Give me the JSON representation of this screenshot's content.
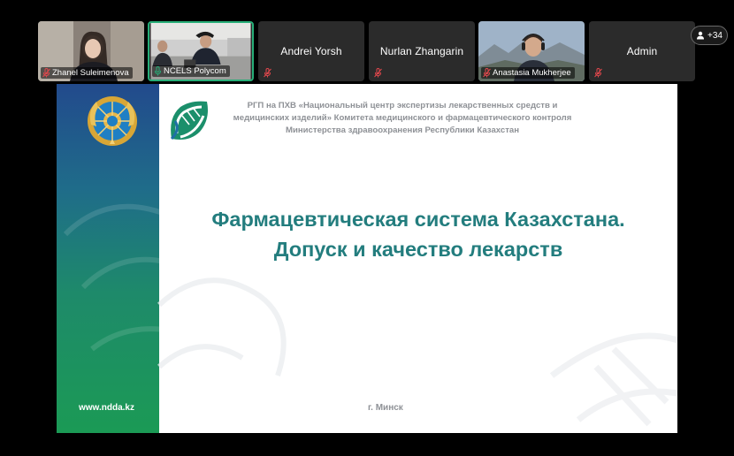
{
  "participants": [
    {
      "name": "Zhanel Suleimenova",
      "video": true,
      "muted": true
    },
    {
      "name": "NCELS Polycom",
      "video": true,
      "muted": false,
      "active": true
    },
    {
      "name": "Andrei Yorsh",
      "video": false,
      "muted": true
    },
    {
      "name": "Nurlan Zhangarin",
      "video": false,
      "muted": true
    },
    {
      "name": "Anastasia Mukherjee",
      "video": true,
      "muted": true
    },
    {
      "name": "Admin",
      "video": false,
      "muted": true
    }
  ],
  "more_participants": "+34",
  "slide": {
    "organization": "РГП на ПХВ «Национальный центр экспертизы лекарственных средств и медицинских изделий» Комитета медицинского и фармацевтического контроля Министерства здравоохранения Республики Казахстан",
    "title_line1": "Фармацевтическая система Казахстана.",
    "title_line2": "Допуск и качество лекарств",
    "website": "www.ndda.kz",
    "city": "г. Минск"
  },
  "colors": {
    "title": "#237d7e",
    "active_border": "#27ae78",
    "muted_icon": "#e0474c",
    "unmuted_icon": "#27ae78"
  }
}
